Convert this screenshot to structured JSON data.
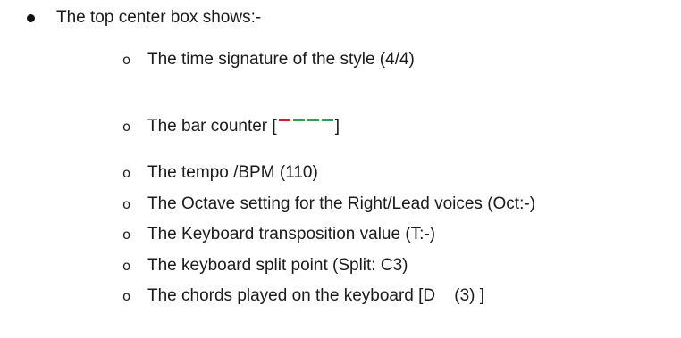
{
  "intro": "The top center box shows:-",
  "list_marker": "o",
  "items": [
    "The time signature of the style (4/4)",
    "The tempo /BPM (110)",
    "The Octave setting for the Right/Lead voices (Oct:-)",
    "The Keyboard transposition value (T:-)",
    "The keyboard split point (Split: C3)",
    "The chords played on the keyboard [D    (3) ]"
  ],
  "bar_counter": {
    "label_prefix": "The bar counter [",
    "label_suffix": "]",
    "active_color": "#e8151f",
    "inactive_color": "#1ea84b",
    "dash_count": 4,
    "active_index": 0
  }
}
